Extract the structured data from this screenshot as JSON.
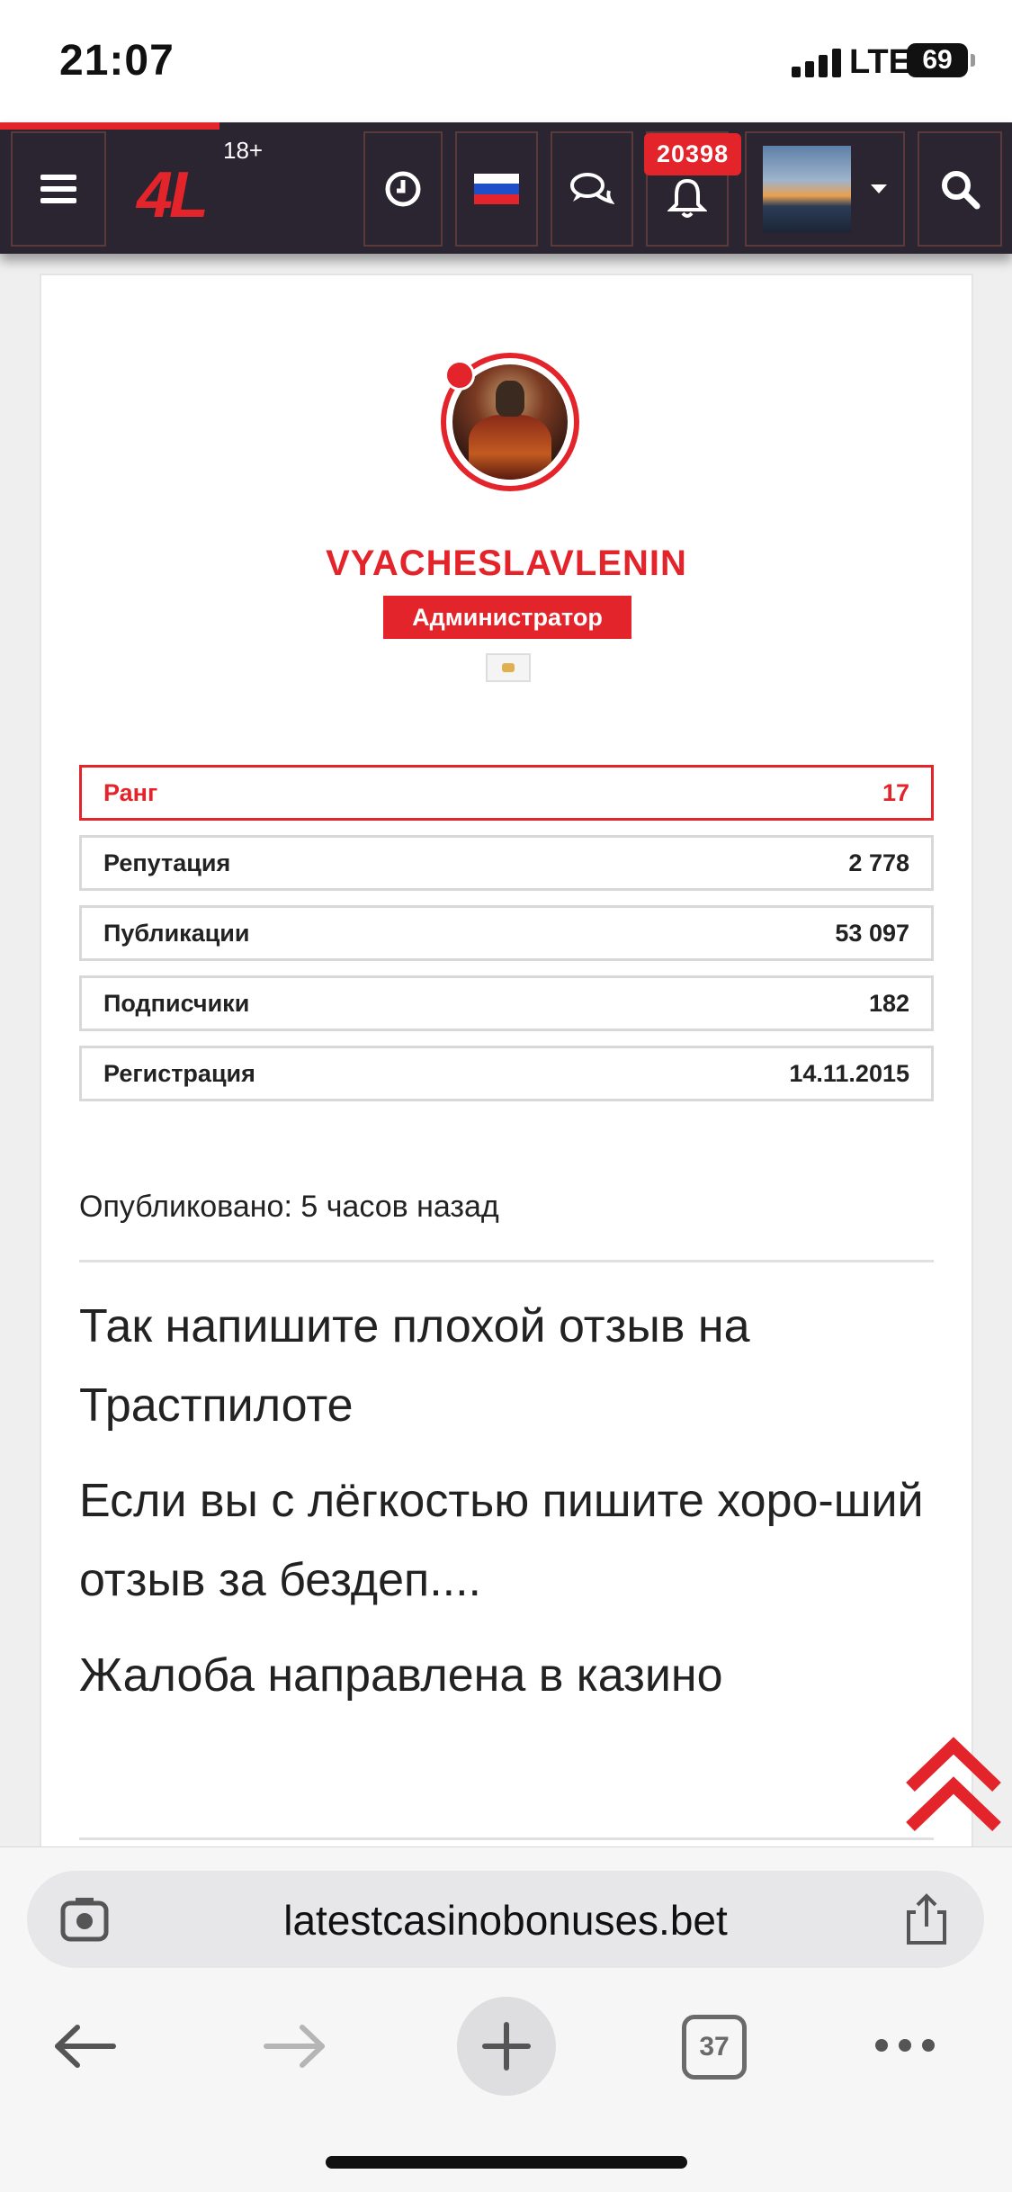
{
  "status_bar": {
    "time": "21:07",
    "network": "LTE",
    "battery": "69"
  },
  "header": {
    "age_label": "18+",
    "logo_text": "4L",
    "notification_count": "20398"
  },
  "profile": {
    "username": "VYACHESLAVLENIN",
    "role": "Администратор",
    "stats": [
      {
        "label": "Ранг",
        "value": "17"
      },
      {
        "label": "Репутация",
        "value": "2 778"
      },
      {
        "label": "Публикации",
        "value": "53 097"
      },
      {
        "label": "Подписчики",
        "value": "182"
      },
      {
        "label": "Регистрация",
        "value": "14.11.2015"
      }
    ]
  },
  "post": {
    "published": "Опубликовано: 5 часов назад",
    "paragraphs": [
      "Так напишите плохой отзыв на Трастпилоте",
      "Если вы с лёгкостью пишите хоро-ший отзыв за бездеп....",
      "Жалоба направлена в казино"
    ]
  },
  "browser": {
    "url": "latestcasinobonuses.bet",
    "tab_count": "37"
  },
  "colors": {
    "accent": "#e3242b",
    "header_bg": "#2a2530"
  },
  "icons": [
    "hamburger-menu-icon",
    "history-circle-icon",
    "russian-flag-icon",
    "chat-bubbles-icon",
    "bell-icon",
    "search-icon",
    "chevron-up-icon",
    "lens-icon",
    "share-icon",
    "back-arrow-icon",
    "forward-arrow-icon",
    "plus-icon",
    "more-dots-icon"
  ]
}
